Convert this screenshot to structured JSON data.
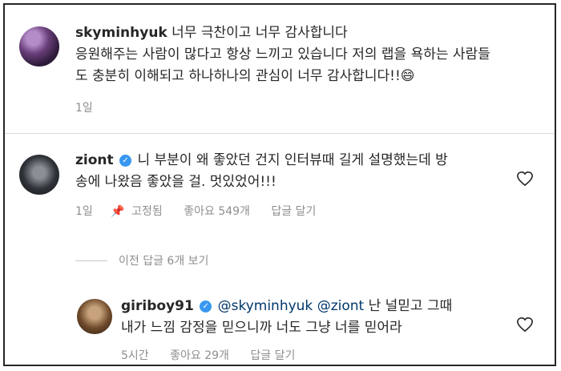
{
  "c1": {
    "username": "skyminhyuk",
    "line1": "너무 극찬이고 너무 감사합니다",
    "line2": "응원해주는 사람이 많다고 항상 느끼고 있습니다 저의 랩을 욕하는 사람들",
    "line3": "도 충분히 이해되고 하나하나의 관심이 너무 감사합니다!!",
    "emoji": "😄",
    "time": "1일"
  },
  "c2": {
    "username": "ziont",
    "line1": "니 부분이 왜 좋았던 건지 인터뷰때 길게 설명했는데 방",
    "line2": "송에 나왔음 좋았을 걸. 멋있었어!!!",
    "time": "1일",
    "pinned": "고정됨",
    "likes": "좋아요 549개",
    "reply": "답글 달기"
  },
  "view_replies": "이전 답글 6개 보기",
  "c3": {
    "username": "giriboy91",
    "mention1": "@skyminhyuk",
    "mention2": "@ziont",
    "line1rest": "난 널믿고 그때",
    "line2": "내가 느낌 감정을 믿으니까 너도 그냥 너를 믿어라",
    "time": "5시간",
    "likes": "좋아요 29개",
    "reply": "답글 달기"
  }
}
